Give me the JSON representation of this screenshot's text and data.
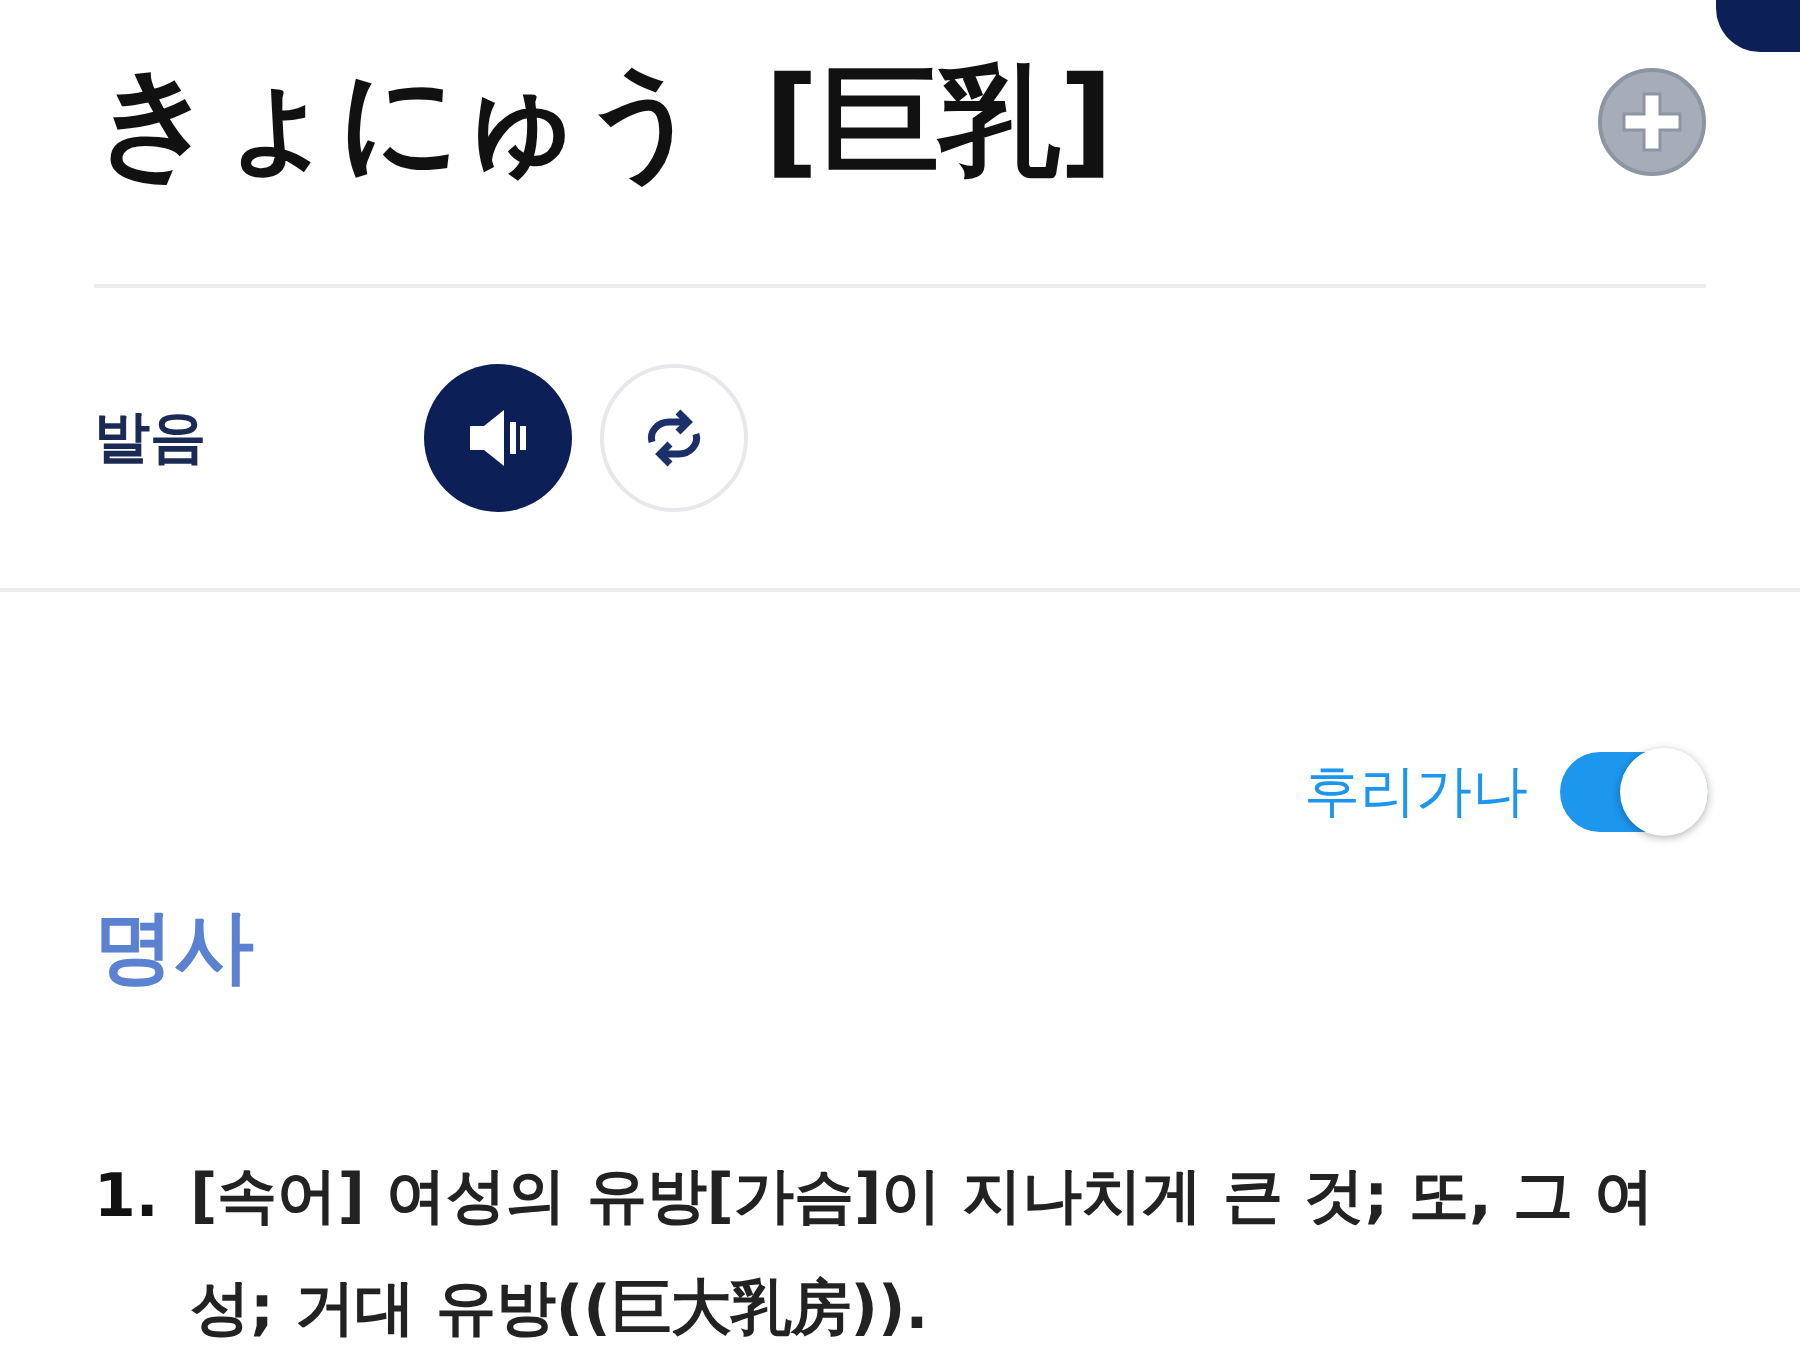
{
  "entry": {
    "reading": "きょにゅう",
    "kanji": "[巨乳]"
  },
  "pronunciation": {
    "label": "발음"
  },
  "furigana": {
    "label": "후리가나",
    "on": true
  },
  "part_of_speech": "명사",
  "senses": [
    {
      "number": "1.",
      "text": "[속어] 여성의 유방[가슴]이 지나치게 큰 것; 또, 그 여성; 거대 유방((巨大乳房))."
    }
  ]
}
